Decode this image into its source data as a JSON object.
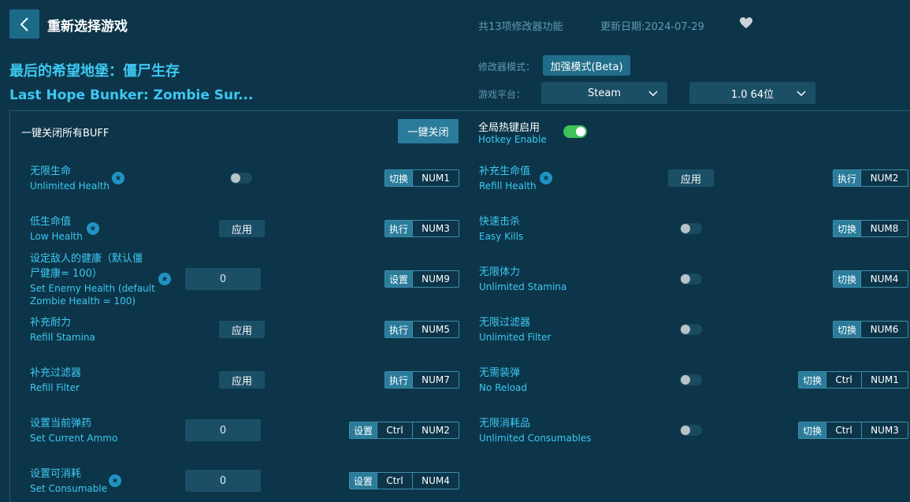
{
  "header": {
    "title": "重新选择游戏",
    "feature_count": "共13项修改器功能",
    "update_date": "更新日期:2024-07-29"
  },
  "game": {
    "name_zh": "最后的希望地堡：僵尸生存",
    "name_en": "Last Hope Bunker: Zombie Sur..."
  },
  "settings": {
    "mode_label": "修改器模式：",
    "mode_value": "加强模式(Beta)",
    "platform_label": "游戏平台：",
    "platform_value": "Steam",
    "version_value": "1.0 64位"
  },
  "controls": {
    "buff_all_label": "一键关闭所有BUFF",
    "close_all_btn": "一键关闭",
    "hotkey_zh": "全局热键启用",
    "hotkey_en": "Hotkey Enable"
  },
  "left": [
    {
      "zh": "无限生命",
      "en": "Unlimited Health",
      "act": "切换",
      "keys": [
        "NUM1"
      ],
      "value": ""
    },
    {
      "zh": "低生命值",
      "en": "Low Health",
      "act": "执行",
      "keys": [
        "NUM3"
      ],
      "value": "应用"
    },
    {
      "zh": "设定敌人的健康（默认僵尸健康= 100）",
      "zh1": "设定敌人的健康（默认僵",
      "zh2": "尸健康= 100）",
      "en1": "Set Enemy Health (default",
      "en2": "Zombie Health = 100)",
      "act": "设置",
      "keys": [
        "NUM9"
      ],
      "value": "0"
    },
    {
      "zh": "补充耐力",
      "en": "Refill Stamina",
      "act": "执行",
      "keys": [
        "NUM5"
      ],
      "value": "应用"
    },
    {
      "zh": "补充过滤器",
      "en": "Refill Filter",
      "act": "执行",
      "keys": [
        "NUM7"
      ],
      "value": "应用"
    },
    {
      "zh": "设置当前弹药",
      "en": "Set Current Ammo",
      "act": "设置",
      "keys": [
        "Ctrl",
        "NUM2"
      ],
      "value": "0"
    },
    {
      "zh": "设置可消耗",
      "en": "Set Consumable",
      "act": "设置",
      "keys": [
        "Ctrl",
        "NUM4"
      ],
      "value": "0"
    }
  ],
  "right": [
    {
      "zh": "补充生命值",
      "en": "Refill Health",
      "act": "执行",
      "keys": [
        "NUM2"
      ],
      "value": "应用"
    },
    {
      "zh": "快速击杀",
      "en": "Easy Kills",
      "act": "切换",
      "keys": [
        "NUM8"
      ]
    },
    {
      "zh": "无限体力",
      "en": "Unlimited Stamina",
      "act": "切换",
      "keys": [
        "NUM4"
      ]
    },
    {
      "zh": "无限过滤器",
      "en": "Unlimited Filter",
      "act": "切换",
      "keys": [
        "NUM6"
      ]
    },
    {
      "zh": "无需装弹",
      "en": "No Reload",
      "act": "切换",
      "keys": [
        "Ctrl",
        "NUM1"
      ]
    },
    {
      "zh": "无限消耗品",
      "en": "Unlimited Consumables",
      "act": "切换",
      "keys": [
        "Ctrl",
        "NUM3"
      ]
    }
  ],
  "colors": {
    "accent": "#3cc8f2",
    "background": "#0d3549",
    "toggle_on": "#3ec25a"
  }
}
